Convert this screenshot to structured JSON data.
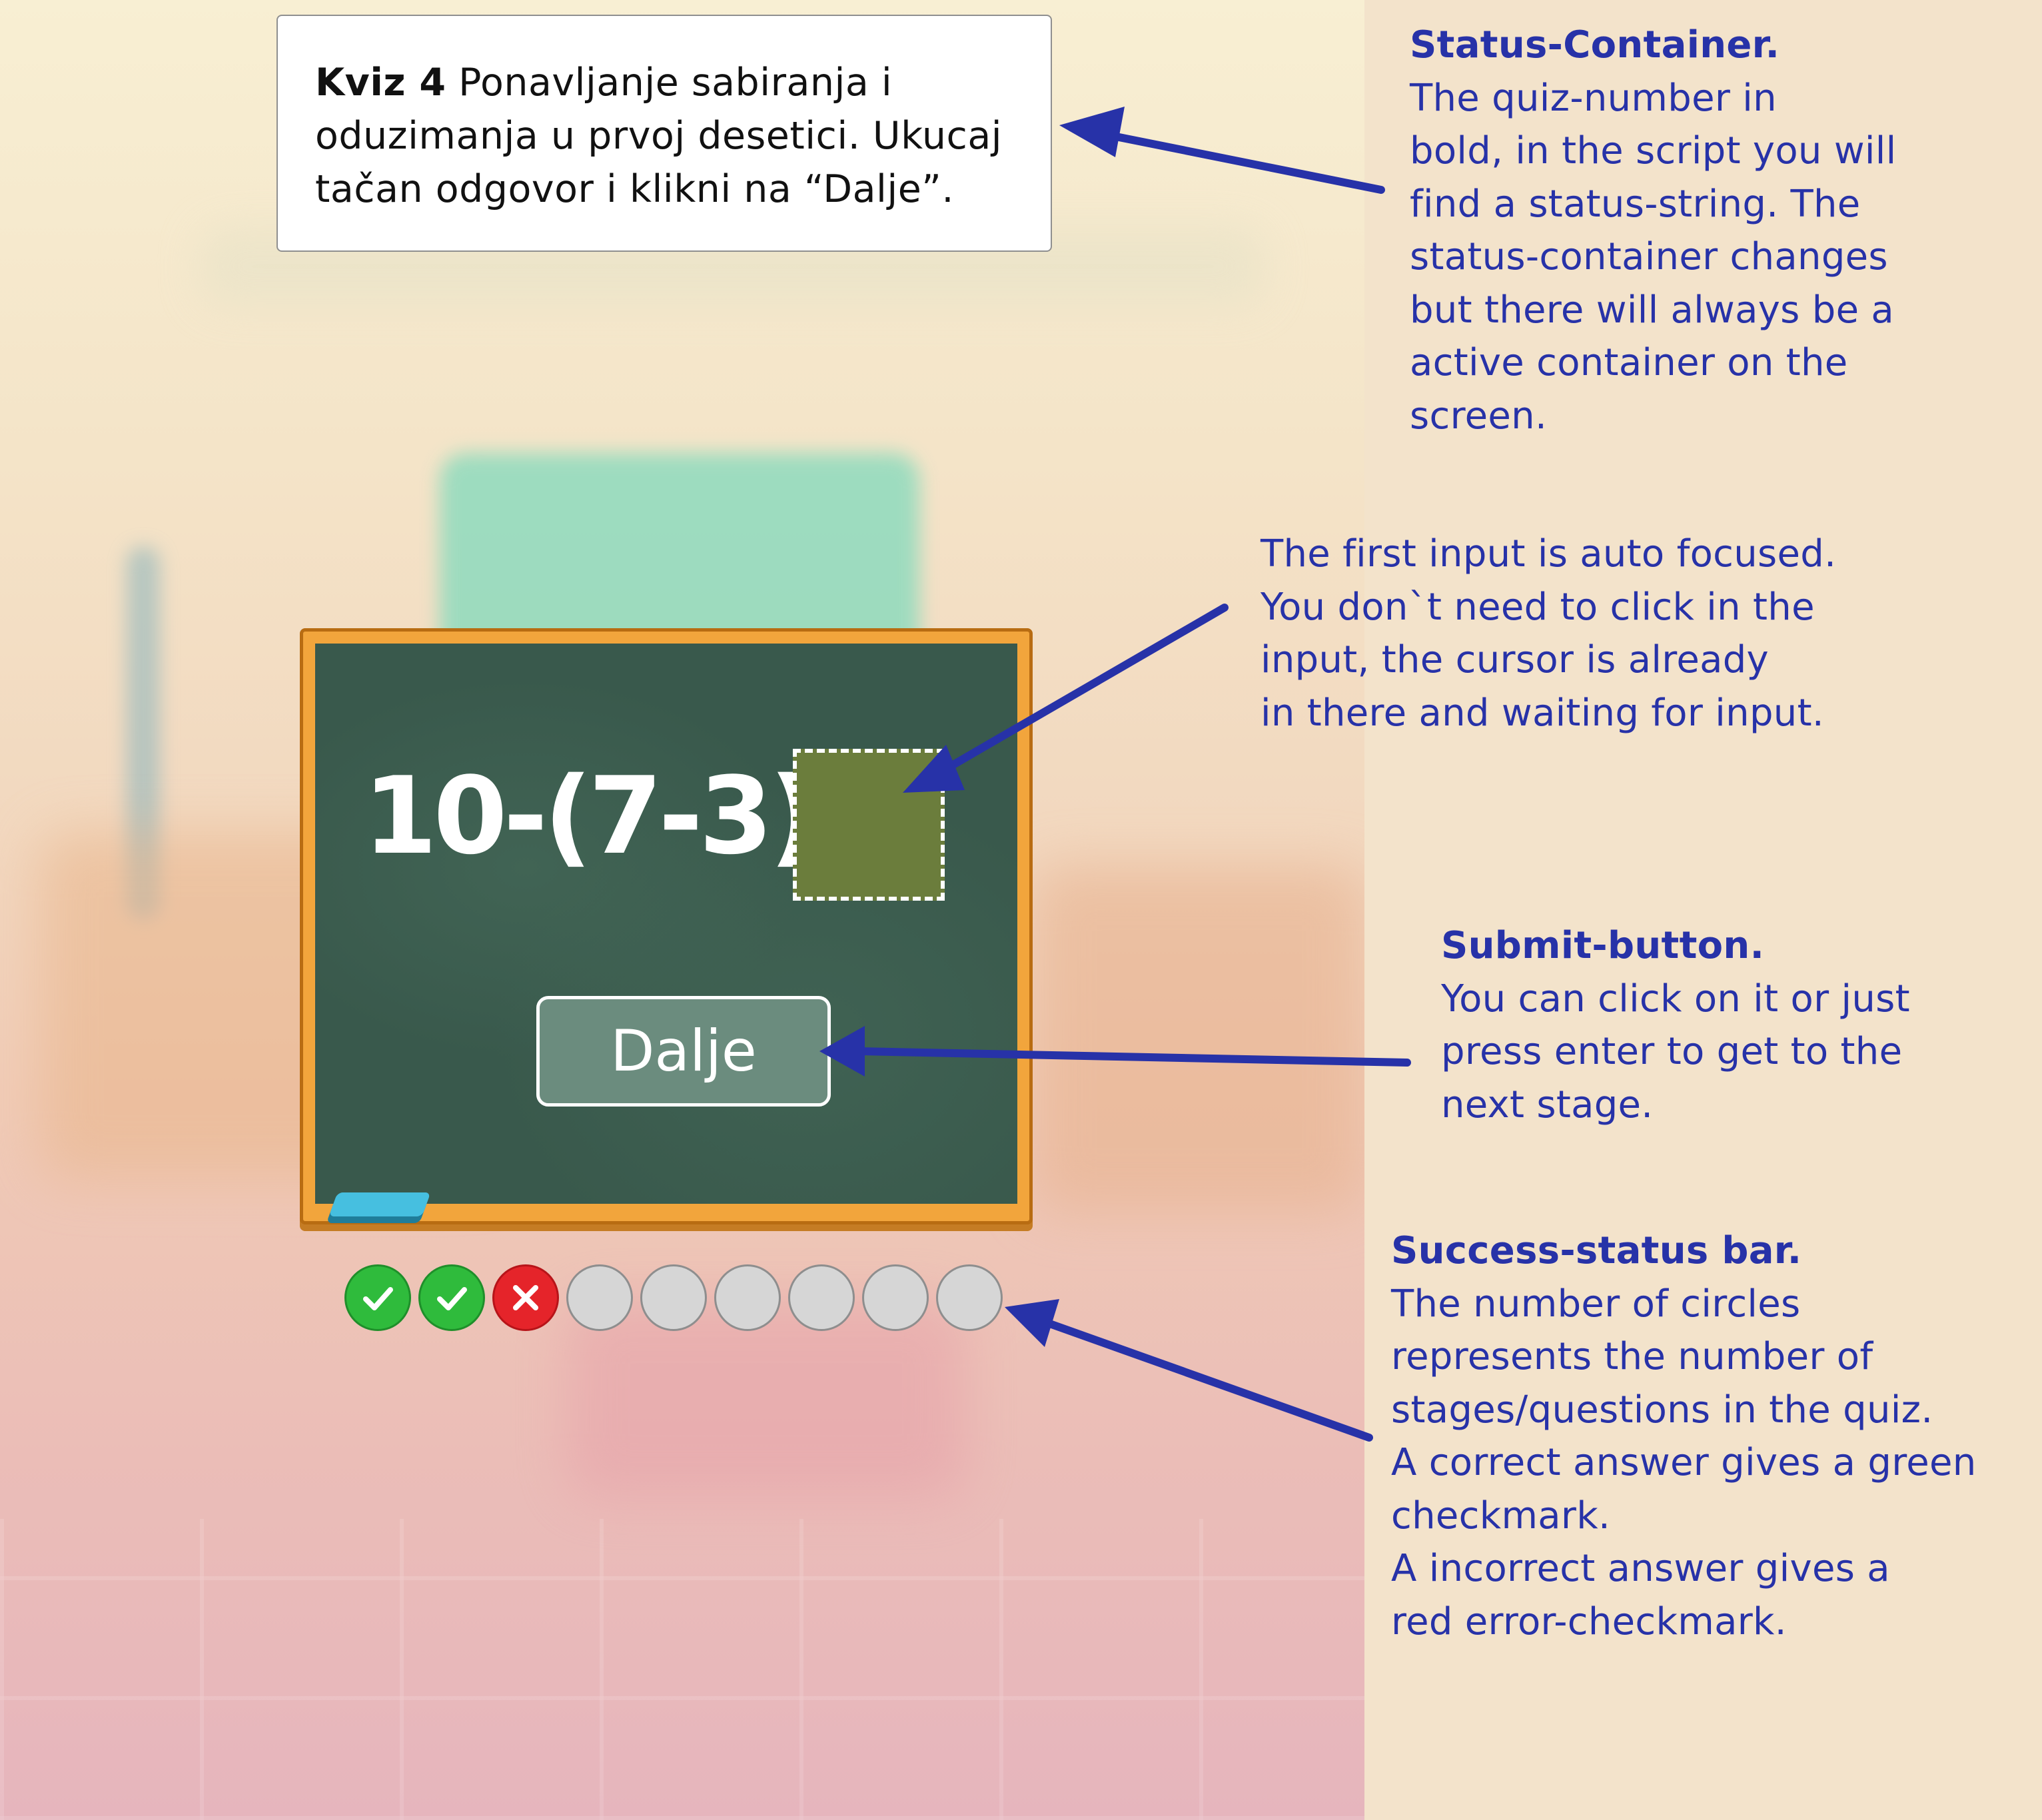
{
  "status": {
    "quiz_label": "Kviz 4",
    "text": " Ponavljanje sabiranja i oduzimanja u prvoj desetici. Ukucaj tačan odgovor i klikni na “Dalje”."
  },
  "quiz": {
    "equation": "10-(7-3)=",
    "answer_value": "",
    "submit_label": "Dalje"
  },
  "progress": {
    "total": 9,
    "results": [
      "correct",
      "correct",
      "wrong",
      "pending",
      "pending",
      "pending",
      "pending",
      "pending",
      "pending"
    ]
  },
  "annotations": {
    "status": {
      "title": "Status-Container.",
      "lines": [
        "The quiz-number in",
        "bold, in the script you will",
        "find a status-string. The",
        "status-container changes",
        "but there will always be a",
        "active container on the",
        "screen."
      ]
    },
    "input": {
      "lines": [
        "The first input is auto focused.",
        "You don`t need to click in the",
        "input, the cursor is already",
        "in there and waiting for input."
      ]
    },
    "submit": {
      "title": "Submit-button.",
      "lines": [
        "You can click on it or just",
        "press enter to get to the",
        "next stage."
      ]
    },
    "progress": {
      "title": "Success-status bar.",
      "lines": [
        "The number of circles",
        "represents the number of",
        "stages/questions in the quiz.",
        "A correct answer gives a green",
        "checkmark.",
        "A incorrect answer gives a",
        "red error-checkmark."
      ]
    }
  },
  "colors": {
    "annotation_text": "#2732a8",
    "correct": "#2fbb3c",
    "wrong": "#e5242a",
    "pending": "#d6d6d6",
    "chalkboard": "#39594c",
    "frame": "#f2a53c"
  }
}
